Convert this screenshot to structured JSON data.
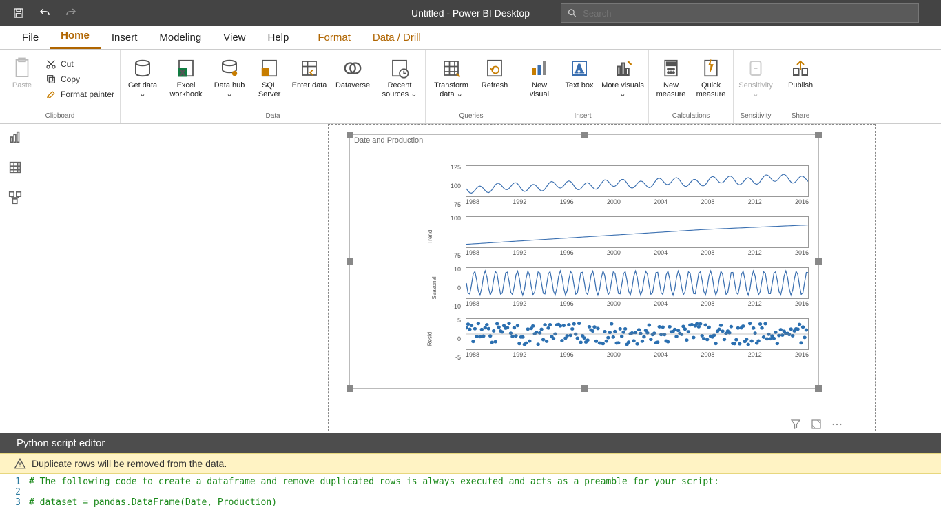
{
  "titlebar": {
    "title": "Untitled - Power BI Desktop",
    "search_placeholder": "Search"
  },
  "menu": {
    "file": "File",
    "home": "Home",
    "insert": "Insert",
    "modeling": "Modeling",
    "view": "View",
    "help": "Help",
    "format": "Format",
    "data_drill": "Data / Drill"
  },
  "ribbon": {
    "group_clipboard": "Clipboard",
    "group_data": "Data",
    "group_queries": "Queries",
    "group_insert": "Insert",
    "group_calc": "Calculations",
    "group_sens": "Sensitivity",
    "group_share": "Share",
    "paste": "Paste",
    "cut": "Cut",
    "copy": "Copy",
    "format_painter": "Format painter",
    "get_data": "Get data ⌄",
    "excel": "Excel workbook",
    "data_hub": "Data hub ⌄",
    "sql": "SQL Server",
    "enter": "Enter data",
    "dataverse": "Dataverse",
    "recent": "Recent sources ⌄",
    "transform": "Transform data ⌄",
    "refresh": "Refresh",
    "new_visual": "New visual",
    "text_box": "Text box",
    "more_visuals": "More visuals ⌄",
    "new_measure": "New measure",
    "quick_measure": "Quick measure",
    "sensitivity": "Sensitivity ⌄",
    "publish": "Publish"
  },
  "visual": {
    "title": "Date and Production",
    "filter_tip": "Filters",
    "focus_tip": "Focus",
    "more_tip": "More"
  },
  "python": {
    "header": "Python script editor",
    "warning": "Duplicate rows will be removed from the data."
  },
  "code": {
    "l1": "# The following code to create a dataframe and remove duplicated rows is always executed and acts as a preamble for your script:",
    "l2": "",
    "l3": "# dataset = pandas.DataFrame(Date, Production)"
  },
  "chart_data": [
    {
      "type": "line",
      "ylabel": "",
      "ylim": [
        75,
        125
      ],
      "yticks": [
        75,
        100,
        125
      ],
      "x_ticks": [
        1988,
        1992,
        1996,
        2000,
        2004,
        2008,
        2012,
        2016
      ],
      "description": "Observed monthly production 1986–2018 oscillating and rising from ~75 to ~115"
    },
    {
      "type": "line",
      "ylabel": "Trend",
      "ylim": [
        75,
        100
      ],
      "yticks": [
        75,
        100
      ],
      "x_ticks": [
        1988,
        1992,
        1996,
        2000,
        2004,
        2008,
        2012,
        2016
      ],
      "description": "Smooth upward trend from ~70 to ~105 then plateau"
    },
    {
      "type": "line",
      "ylabel": "Seasonal",
      "ylim": [
        -10,
        10
      ],
      "yticks": [
        -10,
        0,
        10
      ],
      "x_ticks": [
        1988,
        1992,
        1996,
        2000,
        2004,
        2008,
        2012,
        2016
      ],
      "description": "Periodic seasonal component oscillating between -10 and +10"
    },
    {
      "type": "scatter",
      "ylabel": "Resid",
      "ylim": [
        -5,
        5
      ],
      "yticks": [
        -5,
        0,
        5
      ],
      "x_ticks": [
        1988,
        1992,
        1996,
        2000,
        2004,
        2008,
        2012,
        2016
      ],
      "description": "Residual noise centered on 0 within ±5"
    }
  ]
}
